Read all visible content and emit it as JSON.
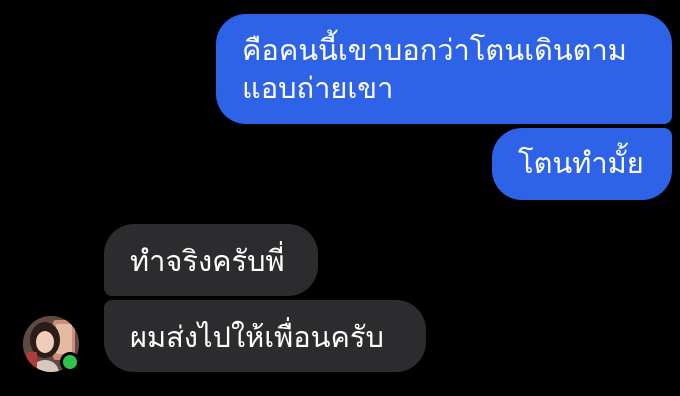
{
  "conversation": {
    "messages": [
      {
        "direction": "sent",
        "lines": [
          "คือคนนี้เขาบอกว่าโตนเดินตาม",
          "แอบถ่ายเขา"
        ]
      },
      {
        "direction": "sent",
        "lines": [
          "โตนทำมั้ย"
        ]
      },
      {
        "direction": "received",
        "lines": [
          "ทำจริงครับพี่"
        ]
      },
      {
        "direction": "received",
        "lines": [
          "ผมส่งไปให้เพื่อนครับ"
        ]
      }
    ],
    "sender_avatar": {
      "online": true,
      "status_color": "#31c24d"
    }
  },
  "colors": {
    "background": "#000000",
    "sent_bubble": "#2e63e8",
    "received_bubble": "#2c2c2e",
    "text": "#ffffff"
  }
}
